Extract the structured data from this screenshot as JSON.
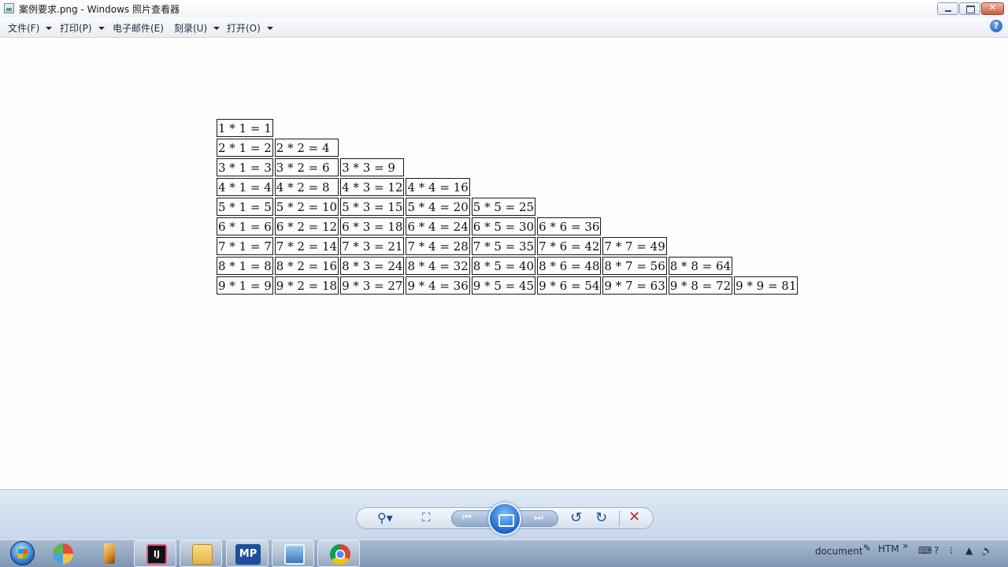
{
  "window": {
    "title": "案例要求.png - Windows 照片查看器"
  },
  "menu": [
    {
      "label": "文件(F)",
      "has_arrow": true
    },
    {
      "label": "打印(P)",
      "has_arrow": true
    },
    {
      "label": "电子邮件(E)",
      "has_arrow": false
    },
    {
      "label": "刻录(U)",
      "has_arrow": true
    },
    {
      "label": "打开(O)",
      "has_arrow": true
    }
  ],
  "image_content": {
    "rows": [
      [
        "1 * 1 = 1"
      ],
      [
        "2 * 1 = 2",
        "2 * 2 = 4"
      ],
      [
        "3 * 1 = 3",
        "3 * 2 = 6",
        "3 * 3 = 9"
      ],
      [
        "4 * 1 = 4",
        "4 * 2 = 8",
        "4 * 3 = 12",
        "4 * 4 = 16"
      ],
      [
        "5 * 1 = 5",
        "5 * 2 = 10",
        "5 * 3 = 15",
        "5 * 4 = 20",
        "5 * 5 = 25"
      ],
      [
        "6 * 1 = 6",
        "6 * 2 = 12",
        "6 * 3 = 18",
        "6 * 4 = 24",
        "6 * 5 = 30",
        "6 * 6 = 36"
      ],
      [
        "7 * 1 = 7",
        "7 * 2 = 14",
        "7 * 3 = 21",
        "7 * 4 = 28",
        "7 * 5 = 35",
        "7 * 6 = 42",
        "7 * 7 = 49"
      ],
      [
        "8 * 1 = 8",
        "8 * 2 = 16",
        "8 * 3 = 24",
        "8 * 4 = 32",
        "8 * 5 = 40",
        "8 * 6 = 48",
        "8 * 7 = 56",
        "8 * 8 = 64"
      ],
      [
        "9 * 1 = 9",
        "9 * 2 = 18",
        "9 * 3 = 27",
        "9 * 4 = 36",
        "9 * 5 = 45",
        "9 * 6 = 54",
        "9 * 7 = 63",
        "9 * 8 = 72",
        "9 * 9 = 81"
      ]
    ]
  },
  "controls": {
    "zoom": "zoom-icon",
    "actual_size": "actual-size-icon",
    "previous": "previous-icon",
    "slideshow": "slideshow-icon",
    "next": "next-icon",
    "rotate_left": "rotate-left-icon",
    "rotate_right": "rotate-right-icon",
    "delete": "delete-icon"
  },
  "taskbar": {
    "apps": [
      {
        "name": "paint-app-icon",
        "active": false
      },
      {
        "name": "pencil-app-icon",
        "active": false
      },
      {
        "name": "intellij-icon",
        "active": true,
        "label": "IJ"
      },
      {
        "name": "explorer-icon",
        "active": true
      },
      {
        "name": "mp-app-icon",
        "active": true,
        "label": "MP"
      },
      {
        "name": "photo-viewer-icon",
        "active": true
      },
      {
        "name": "chrome-icon",
        "active": true
      }
    ],
    "tray": {
      "document_label": "document",
      "htm_label": "HTM"
    }
  },
  "colors": {
    "accent": "#1f67c7",
    "close_red": "#c62828"
  }
}
